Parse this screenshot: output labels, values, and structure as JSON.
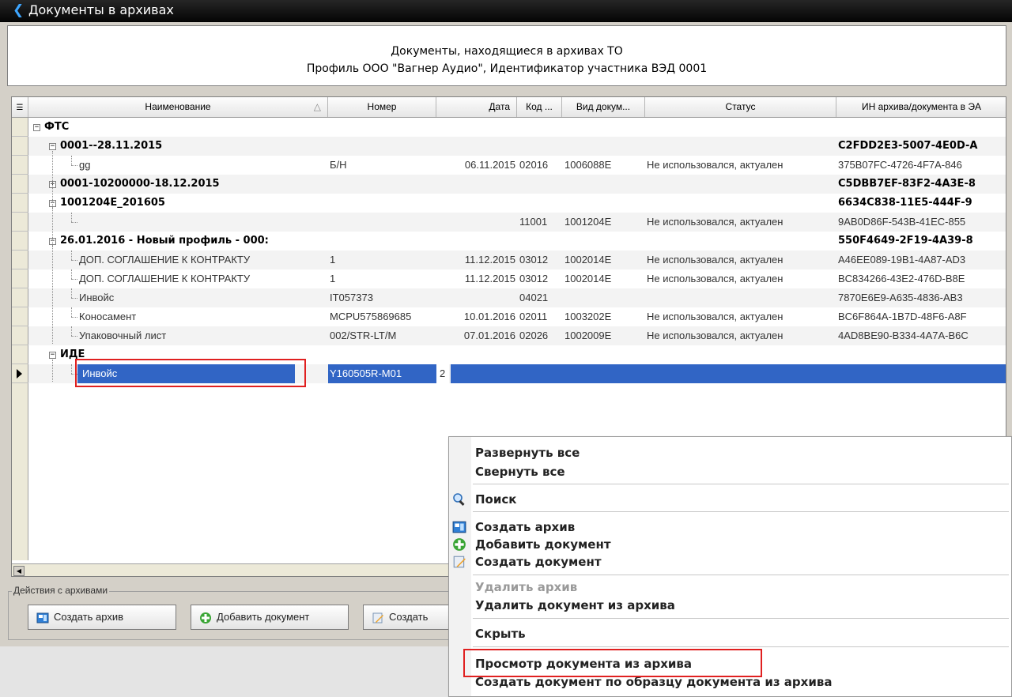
{
  "window": {
    "title": "Документы в архивах"
  },
  "header": {
    "line1": "Документы, находящиеся в архивах ТО",
    "line2": "Профиль ООО \"Вагнер Аудио\", Идентификатор участника ВЭД 0001"
  },
  "grid": {
    "columns": [
      {
        "label": "Наименование",
        "sort": "△"
      },
      {
        "label": "Номер"
      },
      {
        "label": "Дата"
      },
      {
        "label": "Код ..."
      },
      {
        "label": "Вид докум..."
      },
      {
        "label": "Статус"
      },
      {
        "label": "ИН архива/документа в ЭА"
      }
    ],
    "rows": [
      {
        "name": "ФТС",
        "bold": true,
        "level": 0,
        "expander": "−"
      },
      {
        "name": "0001--28.11.2015",
        "bold": true,
        "level": 1,
        "expander": "−",
        "id": "C2FDD2E3-5007-4E0D-A"
      },
      {
        "name": "gg",
        "level": 2,
        "number": "Б/Н",
        "date": "06.11.2015",
        "code": "02016",
        "kind": "1006088E",
        "status": "Не использовался, актуален",
        "id": "375B07FC-4726-4F7A-846"
      },
      {
        "name": "0001-10200000-18.12.2015",
        "bold": true,
        "level": 1,
        "expander": "+",
        "id": "C5DBB7EF-83F2-4A3E-8"
      },
      {
        "name": "1001204E_201605",
        "bold": true,
        "level": 1,
        "expander": "−",
        "id": "6634C838-11E5-444F-9"
      },
      {
        "name": "",
        "level": 2,
        "code": "11001",
        "kind": "1001204E",
        "status": "Не использовался, актуален",
        "id": "9AB0D86F-543B-41EC-855"
      },
      {
        "name": "26.01.2016 - Новый профиль - 000:",
        "bold": true,
        "level": 1,
        "expander": "−",
        "id": "550F4649-2F19-4A39-8"
      },
      {
        "name": "ДОП. СОГЛАШЕНИЕ К КОНТРАКТУ",
        "level": 2,
        "number": "1",
        "date": "11.12.2015",
        "code": "03012",
        "kind": "1002014E",
        "status": "Не использовался, актуален",
        "id": "A46EE089-19B1-4A87-AD3"
      },
      {
        "name": "ДОП. СОГЛАШЕНИЕ К КОНТРАКТУ",
        "level": 2,
        "number": "1",
        "date": "11.12.2015",
        "code": "03012",
        "kind": "1002014E",
        "status": "Не использовался, актуален",
        "id": "BC834266-43E2-476D-B8E"
      },
      {
        "name": "Инвойс",
        "level": 2,
        "number": "IT057373",
        "code": "04021",
        "id": "7870E6E9-A635-4836-AB3"
      },
      {
        "name": "Коносамент",
        "level": 2,
        "number": "MCPU575869685",
        "date": "10.01.2016",
        "code": "02011",
        "kind": "1003202E",
        "status": "Не использовался, актуален",
        "id": "BC6F864A-1B7D-48F6-A8F"
      },
      {
        "name": "Упаковочный лист",
        "level": 2,
        "number": "002/STR-LT/M",
        "date": "07.01.2016",
        "code": "02026",
        "kind": "1002009E",
        "status": "Не использовался, актуален",
        "id": "4AD8BE90-B334-4A7A-B6C"
      },
      {
        "name": "ИДЕ",
        "bold": true,
        "level": 1,
        "expander": "−"
      },
      {
        "name": "Инвойс",
        "level": 2,
        "number": "Y160505R-M01",
        "date": "2",
        "selected": true
      }
    ]
  },
  "actions": {
    "group_label": "Действия с архивами",
    "create_archive": "Создать архив",
    "add_document": "Добавить документ",
    "create_document": "Создать"
  },
  "context_menu": {
    "items": [
      {
        "label": "Развернуть все"
      },
      {
        "label": "Свернуть все"
      },
      {
        "label": "Поиск",
        "icon": "search-icon"
      },
      {
        "label": "Создать архив",
        "icon": "archive-icon"
      },
      {
        "label": "Добавить документ",
        "icon": "plus-icon"
      },
      {
        "label": "Создать документ",
        "icon": "edit-icon"
      },
      {
        "label": "Удалить архив",
        "disabled": true
      },
      {
        "label": "Удалить документ из архива"
      },
      {
        "label": "Скрыть"
      },
      {
        "label": "Просмотр документа из архива"
      },
      {
        "label": "Создать документ по образцу документа из архива"
      }
    ]
  },
  "colors": {
    "selection": "#3165c5",
    "highlight": "#e02020"
  }
}
